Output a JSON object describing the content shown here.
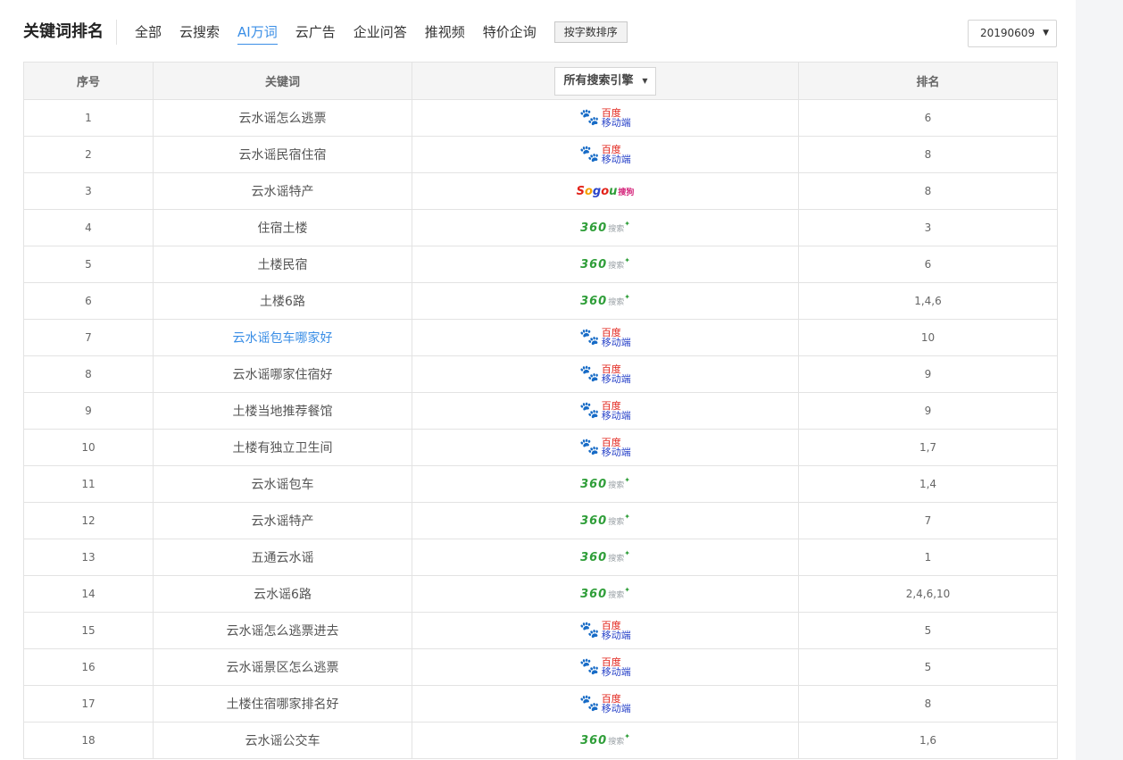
{
  "header": {
    "title": "关键词排名",
    "tabs": [
      {
        "label": "全部",
        "active": false
      },
      {
        "label": "云搜索",
        "active": false
      },
      {
        "label": "AI万词",
        "active": true
      },
      {
        "label": "云广告",
        "active": false
      },
      {
        "label": "企业问答",
        "active": false
      },
      {
        "label": "推视频",
        "active": false
      },
      {
        "label": "特价企询",
        "active": false
      }
    ],
    "sort_button": "按字数排序",
    "date_select": "20190609"
  },
  "table": {
    "columns": [
      "序号",
      "关键词",
      "所有搜索引擎",
      "排名"
    ],
    "engine_labels": {
      "baidu_line1": "百度",
      "baidu_line2": "移动端",
      "so360_brand": "360",
      "so360_text": "搜索",
      "sogou_brand": "Sogou",
      "sogou_text": "搜狗"
    },
    "colors": {
      "accent": "#3a8ee6",
      "baidu_blue": "#2a44c9",
      "baidu_red": "#e2231a",
      "so360_green": "#2f9e39"
    },
    "rows": [
      {
        "num": "1",
        "keyword": "云水谣怎么逃票",
        "engine": "baidu",
        "rank": "6"
      },
      {
        "num": "2",
        "keyword": "云水谣民宿住宿",
        "engine": "baidu",
        "rank": "8"
      },
      {
        "num": "3",
        "keyword": "云水谣特产",
        "engine": "sogou",
        "rank": "8"
      },
      {
        "num": "4",
        "keyword": "住宿土楼",
        "engine": "360",
        "rank": "3"
      },
      {
        "num": "5",
        "keyword": "土楼民宿",
        "engine": "360",
        "rank": "6"
      },
      {
        "num": "6",
        "keyword": "土楼6路",
        "engine": "360",
        "rank": "1,4,6"
      },
      {
        "num": "7",
        "keyword": "云水谣包车哪家好",
        "engine": "baidu",
        "rank": "10",
        "highlight": true
      },
      {
        "num": "8",
        "keyword": "云水谣哪家住宿好",
        "engine": "baidu",
        "rank": "9"
      },
      {
        "num": "9",
        "keyword": "土楼当地推荐餐馆",
        "engine": "baidu",
        "rank": "9"
      },
      {
        "num": "10",
        "keyword": "土楼有独立卫生间",
        "engine": "baidu",
        "rank": "1,7"
      },
      {
        "num": "11",
        "keyword": "云水谣包车",
        "engine": "360",
        "rank": "1,4"
      },
      {
        "num": "12",
        "keyword": "云水谣特产",
        "engine": "360",
        "rank": "7"
      },
      {
        "num": "13",
        "keyword": "五通云水谣",
        "engine": "360",
        "rank": "1"
      },
      {
        "num": "14",
        "keyword": "云水谣6路",
        "engine": "360",
        "rank": "2,4,6,10"
      },
      {
        "num": "15",
        "keyword": "云水谣怎么逃票进去",
        "engine": "baidu",
        "rank": "5"
      },
      {
        "num": "16",
        "keyword": "云水谣景区怎么逃票",
        "engine": "baidu",
        "rank": "5"
      },
      {
        "num": "17",
        "keyword": "土楼住宿哪家排名好",
        "engine": "baidu",
        "rank": "8"
      },
      {
        "num": "18",
        "keyword": "云水谣公交车",
        "engine": "360",
        "rank": "1,6"
      }
    ]
  }
}
